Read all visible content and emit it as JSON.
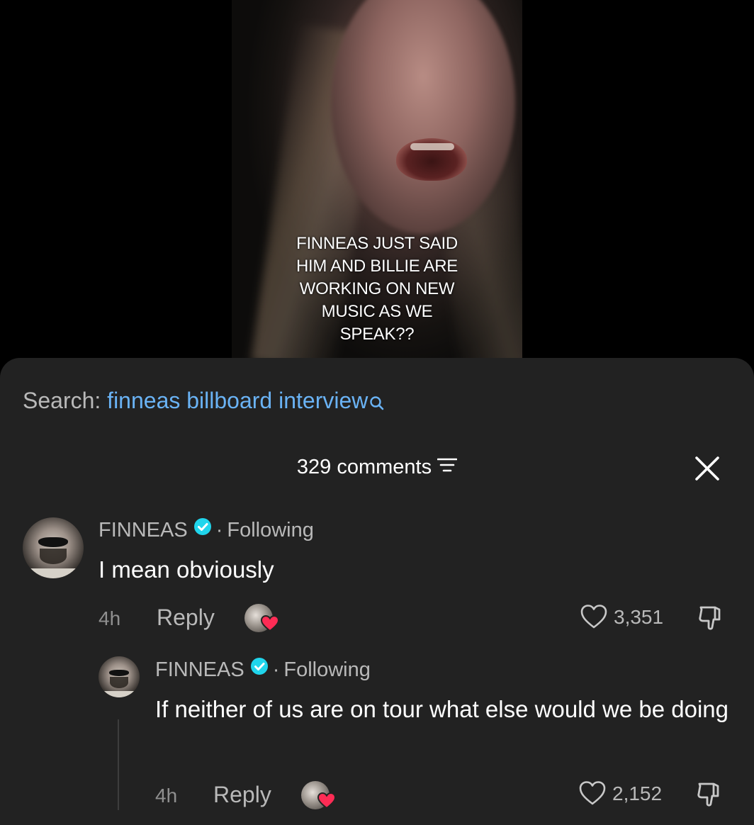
{
  "video": {
    "overlay_text": "FINNEAS JUST SAID\nHIM AND BILLIE ARE\nWORKING ON NEW\nMUSIC AS WE\nSPEAK??"
  },
  "search": {
    "label": "Search:",
    "term": "finneas billboard interview",
    "icon": "search-icon"
  },
  "header": {
    "comment_count": "329 comments",
    "filter_icon": "filter-icon",
    "close_icon": "close-icon"
  },
  "comments": [
    {
      "author": "FINNEAS",
      "verified": true,
      "status": "Following",
      "text": "I mean obviously",
      "time": "4h",
      "reply_label": "Reply",
      "likes": "3,351"
    },
    {
      "author": "FINNEAS",
      "verified": true,
      "status": "Following",
      "text": "If neither of us are on tour what else would we be doing",
      "time": "4h",
      "reply_label": "Reply",
      "likes": "2,152"
    }
  ],
  "colors": {
    "sheet_bg": "#222222",
    "search_term": "#6ab3f5",
    "verified_badge": "#20d5ec",
    "heart_badge": "#fe2c55",
    "secondary_text": "#b9b9b9"
  }
}
